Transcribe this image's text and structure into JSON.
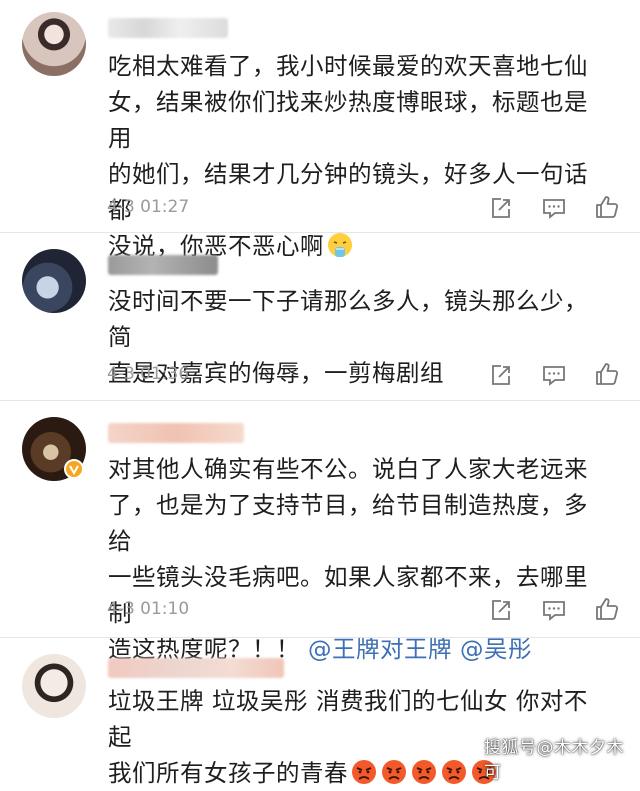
{
  "comments": [
    {
      "text_lines": [
        "吃相太难看了，我小时候最爱的欢天喜地七仙",
        "女，结果被你们找来炒热度博眼球，标题也是用",
        "的她们，结果才几分钟的镜头，好多人一句话都",
        "没说，你恶不恶心啊"
      ],
      "emoji": "vomit-emoji",
      "time": "4-3 01:27",
      "verified": false
    },
    {
      "text_lines": [
        "没时间不要一下子请那么多人，镜头那么少，简",
        "直是对嘉宾的侮辱，一剪梅剧组"
      ],
      "time": "4-3 01:36",
      "verified": false
    },
    {
      "text_lines": [
        "对其他人确实有些不公。说白了人家大老远来",
        "了，也是为了支持节目，给节目制造热度，多给",
        "一些镜头没毛病吧。如果人家都不来，去哪里制"
      ],
      "last_line_prefix": "造这热度呢？！！",
      "mentions": [
        "@王牌对王牌",
        "@吴彤"
      ],
      "time": "4-3 01:10",
      "verified": true
    },
    {
      "text_lines": [
        "垃圾王牌 垃圾吴彤 消费我们的七仙女 你对不起",
        "我们所有女孩子的青春"
      ],
      "emoji_count": 5,
      "emoji": "angry-emoji",
      "verified": false
    }
  ],
  "icons": {
    "share": "share-icon",
    "comment": "comment-icon",
    "like": "like-icon"
  },
  "watermark": "搜狐号@木木夕木可",
  "colors": {
    "text": "#1e1e1e",
    "time": "#9a9a9a",
    "mention": "#3d6fb4",
    "separator": "#e6e6e6",
    "verified_badge": "#f5a623"
  }
}
